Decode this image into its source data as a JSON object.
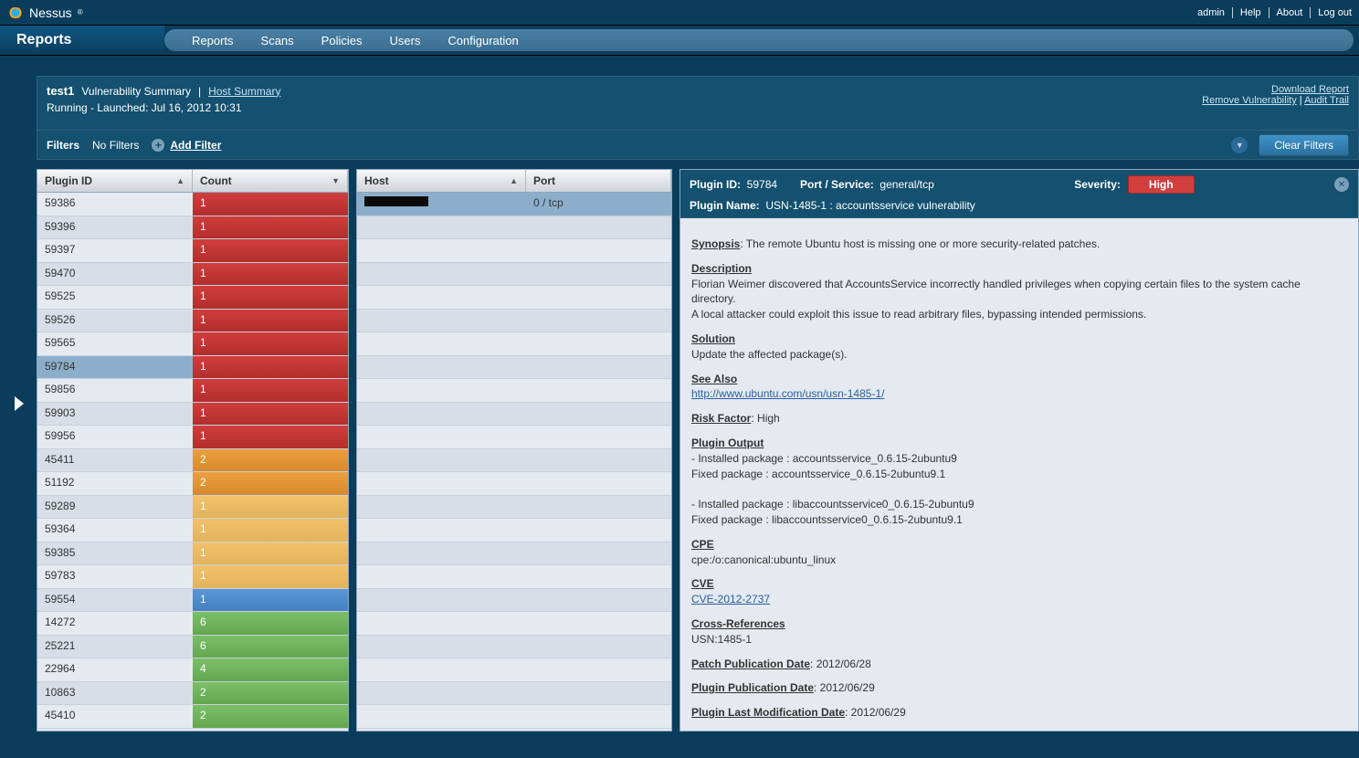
{
  "brand": "Nessus",
  "toplinks": {
    "user": "admin",
    "help": "Help",
    "about": "About",
    "logout": "Log out"
  },
  "section": "Reports",
  "nav": [
    "Reports",
    "Scans",
    "Policies",
    "Users",
    "Configuration"
  ],
  "report": {
    "name": "test1",
    "summary_label": "Vulnerability Summary",
    "host_summary_label": "Host Summary",
    "status": "Running - Launched: Jul 16, 2012 10:31",
    "links": {
      "download": "Download Report",
      "remove": "Remove Vulnerability",
      "audit": "Audit Trail"
    }
  },
  "filters": {
    "label": "Filters",
    "value": "No Filters",
    "add": "Add Filter",
    "clear": "Clear Filters"
  },
  "cols": {
    "plugin": "Plugin ID",
    "count": "Count",
    "host": "Host",
    "port": "Port"
  },
  "selected_plugin": "59784",
  "plugins": [
    {
      "id": "59386",
      "count": "1",
      "sev": "high"
    },
    {
      "id": "59396",
      "count": "1",
      "sev": "high"
    },
    {
      "id": "59397",
      "count": "1",
      "sev": "high"
    },
    {
      "id": "59470",
      "count": "1",
      "sev": "high"
    },
    {
      "id": "59525",
      "count": "1",
      "sev": "high"
    },
    {
      "id": "59526",
      "count": "1",
      "sev": "high"
    },
    {
      "id": "59565",
      "count": "1",
      "sev": "high"
    },
    {
      "id": "59784",
      "count": "1",
      "sev": "high"
    },
    {
      "id": "59856",
      "count": "1",
      "sev": "high"
    },
    {
      "id": "59903",
      "count": "1",
      "sev": "high"
    },
    {
      "id": "59956",
      "count": "1",
      "sev": "high"
    },
    {
      "id": "45411",
      "count": "2",
      "sev": "med"
    },
    {
      "id": "51192",
      "count": "2",
      "sev": "med"
    },
    {
      "id": "59289",
      "count": "1",
      "sev": "low"
    },
    {
      "id": "59364",
      "count": "1",
      "sev": "low"
    },
    {
      "id": "59385",
      "count": "1",
      "sev": "low"
    },
    {
      "id": "59783",
      "count": "1",
      "sev": "low"
    },
    {
      "id": "59554",
      "count": "1",
      "sev": "info"
    },
    {
      "id": "14272",
      "count": "6",
      "sev": "none"
    },
    {
      "id": "25221",
      "count": "6",
      "sev": "none"
    },
    {
      "id": "22964",
      "count": "4",
      "sev": "none"
    },
    {
      "id": "10863",
      "count": "2",
      "sev": "none"
    },
    {
      "id": "45410",
      "count": "2",
      "sev": "none"
    }
  ],
  "hosts": [
    {
      "host": "[redacted]",
      "port": "0 / tcp"
    }
  ],
  "detail": {
    "plugin_id_label": "Plugin ID:",
    "plugin_id": "59784",
    "port_label": "Port / Service:",
    "port": "general/tcp",
    "severity_label": "Severity:",
    "severity": "High",
    "name_label": "Plugin Name:",
    "name": "USN-1485-1 : accountsservice vulnerability",
    "synopsis_label": "Synopsis",
    "synopsis": ": The remote Ubuntu host is missing one or more security-related patches.",
    "description_label": "Description",
    "description1": "Florian Weimer discovered that AccountsService incorrectly handled privileges when copying certain files to the system cache directory.",
    "description2": "A local attacker could exploit this issue to read arbitrary files, bypassing intended permissions.",
    "solution_label": "Solution",
    "solution": "Update the affected package(s).",
    "seealso_label": "See Also",
    "seealso": "http://www.ubuntu.com/usn/usn-1485-1/",
    "risk_label": "Risk Factor",
    "risk": ": High",
    "output_label": "Plugin Output",
    "output_lines": [
      "- Installed package : accountsservice_0.6.15-2ubuntu9",
      "  Fixed package : accountsservice_0.6.15-2ubuntu9.1",
      "",
      "  - Installed package : libaccountsservice0_0.6.15-2ubuntu9",
      "  Fixed package : libaccountsservice0_0.6.15-2ubuntu9.1"
    ],
    "cpe_label": "CPE",
    "cpe": "cpe:/o:canonical:ubuntu_linux",
    "cve_label": "CVE",
    "cve": "CVE-2012-2737",
    "xref_label": "Cross-References",
    "xref": "USN:1485-1",
    "patch_label": "Patch Publication Date",
    "patch": ": 2012/06/28",
    "pub_label": "Plugin Publication Date",
    "pub": ": 2012/06/29",
    "mod_label": "Plugin Last Modification Date",
    "mod": ": 2012/06/29"
  }
}
